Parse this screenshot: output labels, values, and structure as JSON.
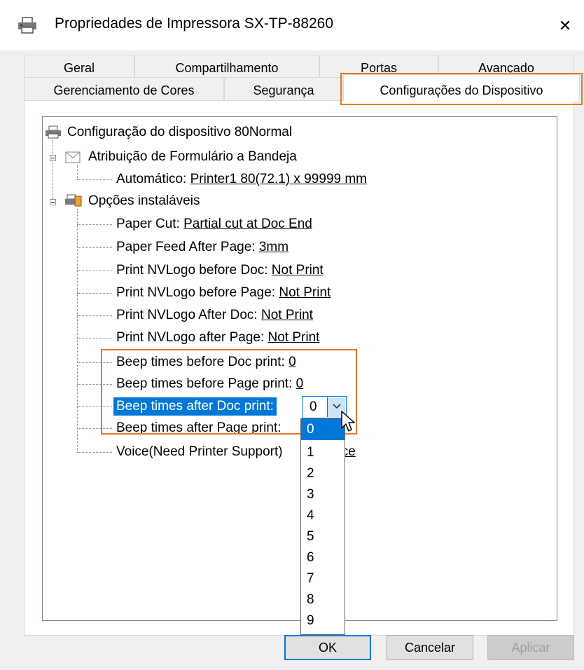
{
  "window": {
    "title": "Propriedades de Impressora SX-TP-88260",
    "close": "✕"
  },
  "tabs": {
    "back_row": [
      "Geral",
      "Compartilhamento",
      "Portas",
      "Avançado"
    ],
    "front_row": [
      "Gerenciamento de Cores",
      "Segurança",
      "Configurações do Dispositivo"
    ],
    "active": "Configurações do Dispositivo"
  },
  "tree": {
    "root": "Configuração do dispositivo 80Normal",
    "form_assignment": {
      "label": "Atribuição de Formulário a Bandeja",
      "auto_key": "Automático:",
      "auto_value": "Printer1 80(72.1) x 99999 mm"
    },
    "installable": {
      "label": "Opções instaláveis",
      "items": [
        {
          "key": "Paper Cut:",
          "value": "Partial cut at Doc End"
        },
        {
          "key": "Paper Feed After Page:",
          "value": "3mm"
        },
        {
          "key": "Print NVLogo before Doc:",
          "value": "Not Print"
        },
        {
          "key": "Print NVLogo before Page:",
          "value": "Not Print"
        },
        {
          "key": "Print NVLogo After Doc:",
          "value": "Not Print"
        },
        {
          "key": "Print NVLogo after Page:",
          "value": "Not Print"
        },
        {
          "key": "Beep times before Doc print:",
          "value": "0"
        },
        {
          "key": "Beep times before Page print:",
          "value": "0"
        },
        {
          "key": "Beep times after Doc print:",
          "value": "0"
        },
        {
          "key": "Beep times after Page print:",
          "value": ""
        },
        {
          "key": "Voice(Need Printer Support)",
          "value": "oice"
        }
      ]
    }
  },
  "combo": {
    "value": "0",
    "options": [
      "0",
      "1",
      "2",
      "3",
      "4",
      "5",
      "6",
      "7",
      "8",
      "9"
    ],
    "selected": "0"
  },
  "buttons": {
    "ok": "OK",
    "cancel": "Cancelar",
    "apply": "Aplicar"
  },
  "colors": {
    "accent": "#0078d7",
    "highlight_border": "#e8762a"
  }
}
